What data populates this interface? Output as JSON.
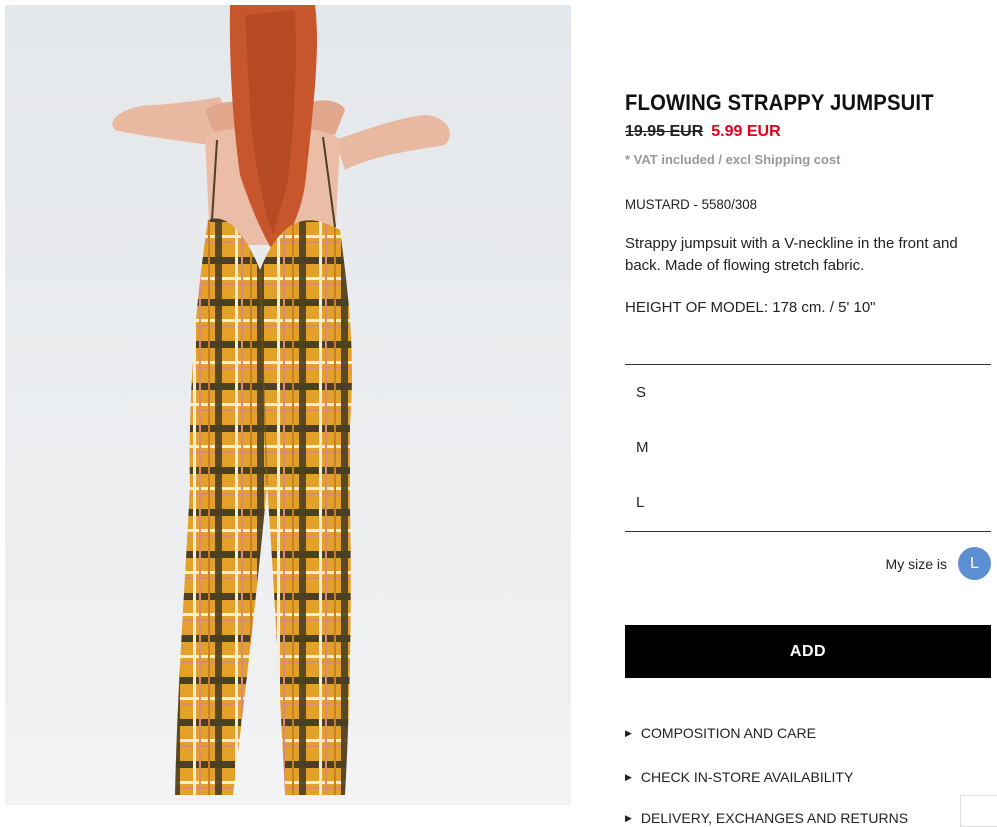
{
  "product": {
    "title": "FLOWING STRAPPY JUMPSUIT",
    "old_price": "19.95 EUR",
    "sale_price": "5.99 EUR",
    "vat_note": "* VAT included / excl Shipping cost",
    "color_ref": "MUSTARD - 5580/308",
    "description": "Strappy jumpsuit with a V-neckline in the front and back. Made of flowing stretch fabric.",
    "model_height": "HEIGHT OF MODEL: 178 cm. / 5' 10\""
  },
  "sizes": [
    "S",
    "M",
    "L"
  ],
  "my_size": {
    "label": "My size is",
    "value": "L"
  },
  "add_button": "ADD",
  "links": [
    "COMPOSITION AND CARE",
    "CHECK IN-STORE AVAILABILITY",
    "DELIVERY, EXCHANGES AND RETURNS"
  ],
  "colors": {
    "sale": "#e2001a",
    "size_badge": "#5b8fd1",
    "button_bg": "#000000"
  }
}
